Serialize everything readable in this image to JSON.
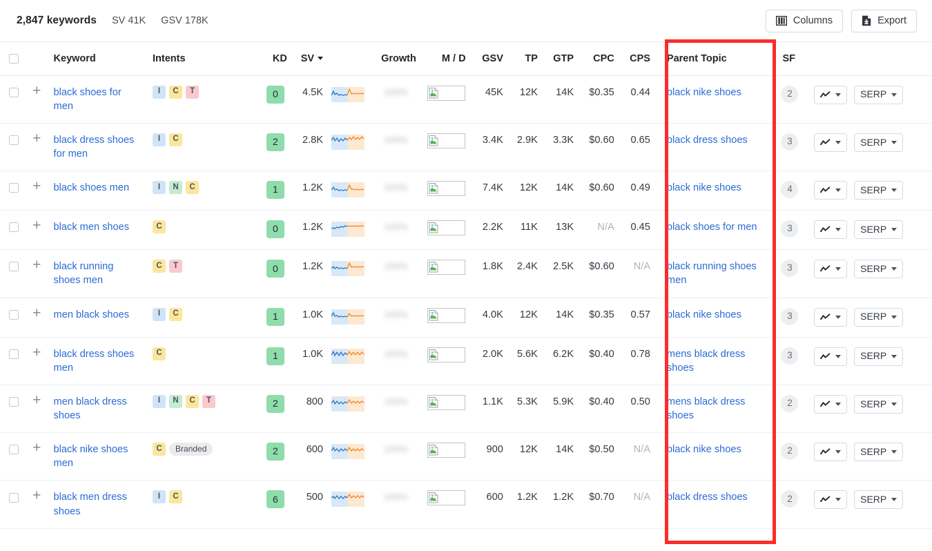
{
  "toolbar": {
    "keyword_count": "2,847 keywords",
    "sv_total": "SV 41K",
    "gsv_total": "GSV 178K",
    "columns_label": "Columns",
    "export_label": "Export",
    "columns_icon": "columns-icon",
    "export_icon": "download-file-icon"
  },
  "table": {
    "headers": {
      "keyword": "Keyword",
      "intents": "Intents",
      "kd": "KD",
      "sv": "SV",
      "growth": "Growth",
      "md": "M / D",
      "gsv": "GSV",
      "tp": "TP",
      "gtp": "GTP",
      "cpc": "CPC",
      "cps": "CPS",
      "parent_topic": "Parent Topic",
      "sf": "SF"
    },
    "sorted_column": "SV",
    "sort_direction": "desc",
    "growth_value_blurred": "100%",
    "rows": [
      {
        "keyword": "black shoes for men",
        "intents": [
          "I",
          "C",
          "T"
        ],
        "branded": false,
        "kd": "0",
        "sv": "4.5K",
        "gsv": "45K",
        "tp": "12K",
        "gtp": "14K",
        "cpc": "$0.35",
        "cps": "0.44",
        "parent_topic": "black nike shoes",
        "sf": "2",
        "serp_label": "SERP"
      },
      {
        "keyword": "black dress shoes for men",
        "intents": [
          "I",
          "C"
        ],
        "branded": false,
        "kd": "2",
        "sv": "2.8K",
        "gsv": "3.4K",
        "tp": "2.9K",
        "gtp": "3.3K",
        "cpc": "$0.60",
        "cps": "0.65",
        "parent_topic": "black dress shoes",
        "sf": "3",
        "serp_label": "SERP"
      },
      {
        "keyword": "black shoes men",
        "intents": [
          "I",
          "N",
          "C"
        ],
        "branded": false,
        "kd": "1",
        "sv": "1.2K",
        "gsv": "7.4K",
        "tp": "12K",
        "gtp": "14K",
        "cpc": "$0.60",
        "cps": "0.49",
        "parent_topic": "black nike shoes",
        "sf": "4",
        "serp_label": "SERP"
      },
      {
        "keyword": "black men shoes",
        "intents": [
          "C"
        ],
        "branded": false,
        "kd": "0",
        "sv": "1.2K",
        "gsv": "2.2K",
        "tp": "11K",
        "gtp": "13K",
        "cpc": "N/A",
        "cps": "0.45",
        "parent_topic": "black shoes for men",
        "sf": "3",
        "serp_label": "SERP"
      },
      {
        "keyword": "black running shoes men",
        "intents": [
          "C",
          "T"
        ],
        "branded": false,
        "kd": "0",
        "sv": "1.2K",
        "gsv": "1.8K",
        "tp": "2.4K",
        "gtp": "2.5K",
        "cpc": "$0.60",
        "cps": "N/A",
        "parent_topic": "black running shoes men",
        "sf": "3",
        "serp_label": "SERP"
      },
      {
        "keyword": "men black shoes",
        "intents": [
          "I",
          "C"
        ],
        "branded": false,
        "kd": "1",
        "sv": "1.0K",
        "gsv": "4.0K",
        "tp": "12K",
        "gtp": "14K",
        "cpc": "$0.35",
        "cps": "0.57",
        "parent_topic": "black nike shoes",
        "sf": "3",
        "serp_label": "SERP"
      },
      {
        "keyword": "black dress shoes men",
        "intents": [
          "C"
        ],
        "branded": false,
        "kd": "1",
        "sv": "1.0K",
        "gsv": "2.0K",
        "tp": "5.6K",
        "gtp": "6.2K",
        "cpc": "$0.40",
        "cps": "0.78",
        "parent_topic": "mens black dress shoes",
        "sf": "3",
        "serp_label": "SERP"
      },
      {
        "keyword": "men black dress shoes",
        "intents": [
          "I",
          "N",
          "C",
          "T"
        ],
        "branded": false,
        "kd": "2",
        "sv": "800",
        "gsv": "1.1K",
        "tp": "5.3K",
        "gtp": "5.9K",
        "cpc": "$0.40",
        "cps": "0.50",
        "parent_topic": "mens black dress shoes",
        "sf": "2",
        "serp_label": "SERP"
      },
      {
        "keyword": "black nike shoes men",
        "intents": [
          "C"
        ],
        "branded": true,
        "branded_label": "Branded",
        "kd": "2",
        "sv": "600",
        "gsv": "900",
        "tp": "12K",
        "gtp": "14K",
        "cpc": "$0.50",
        "cps": "N/A",
        "parent_topic": "black nike shoes",
        "sf": "2",
        "serp_label": "SERP"
      },
      {
        "keyword": "black men dress shoes",
        "intents": [
          "I",
          "C"
        ],
        "branded": false,
        "kd": "6",
        "sv": "500",
        "gsv": "600",
        "tp": "1.2K",
        "gtp": "1.2K",
        "cpc": "$0.70",
        "cps": "N/A",
        "parent_topic": "black dress shoes",
        "sf": "2",
        "serp_label": "SERP"
      }
    ]
  },
  "annotation": {
    "highlight_color": "#fb2c2c",
    "highlight_target": "Parent Topic"
  }
}
